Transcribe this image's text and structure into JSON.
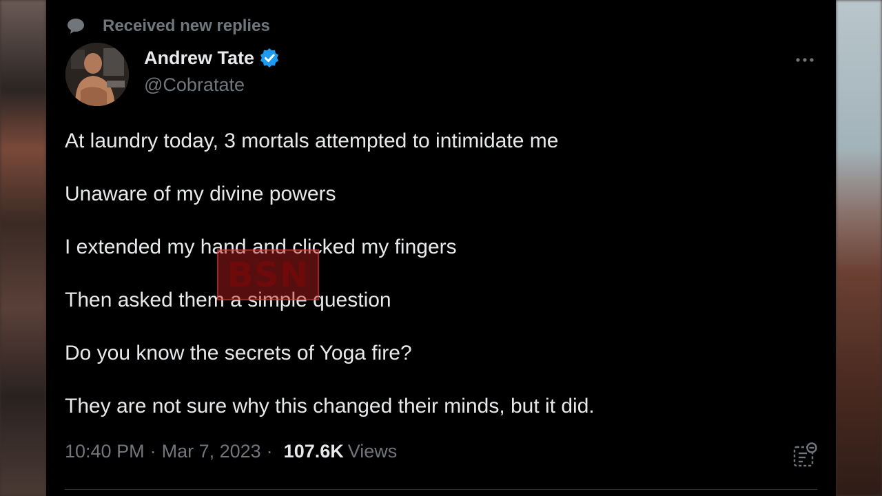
{
  "context": {
    "label": "Received new replies"
  },
  "author": {
    "name": "Andrew Tate",
    "handle": "@Cobratate"
  },
  "tweet": {
    "lines": [
      "At laundry today, 3 mortals attempted to intimidate me",
      "Unaware of my divine powers",
      "I extended my hand and clicked my fingers",
      "Then asked them a simple question",
      "Do you know the secrets of Yoga fire?",
      "They are not sure why this changed their minds, but it did."
    ]
  },
  "meta": {
    "time": "10:40 PM",
    "separator": "·",
    "date": "Mar 7, 2023",
    "views_count": "107.6K",
    "views_label": "Views"
  },
  "watermark": {
    "text": "BSN"
  },
  "colors": {
    "background": "#000000",
    "text": "#e7e9ea",
    "muted": "#71767b",
    "verified": "#1d9bf0"
  }
}
